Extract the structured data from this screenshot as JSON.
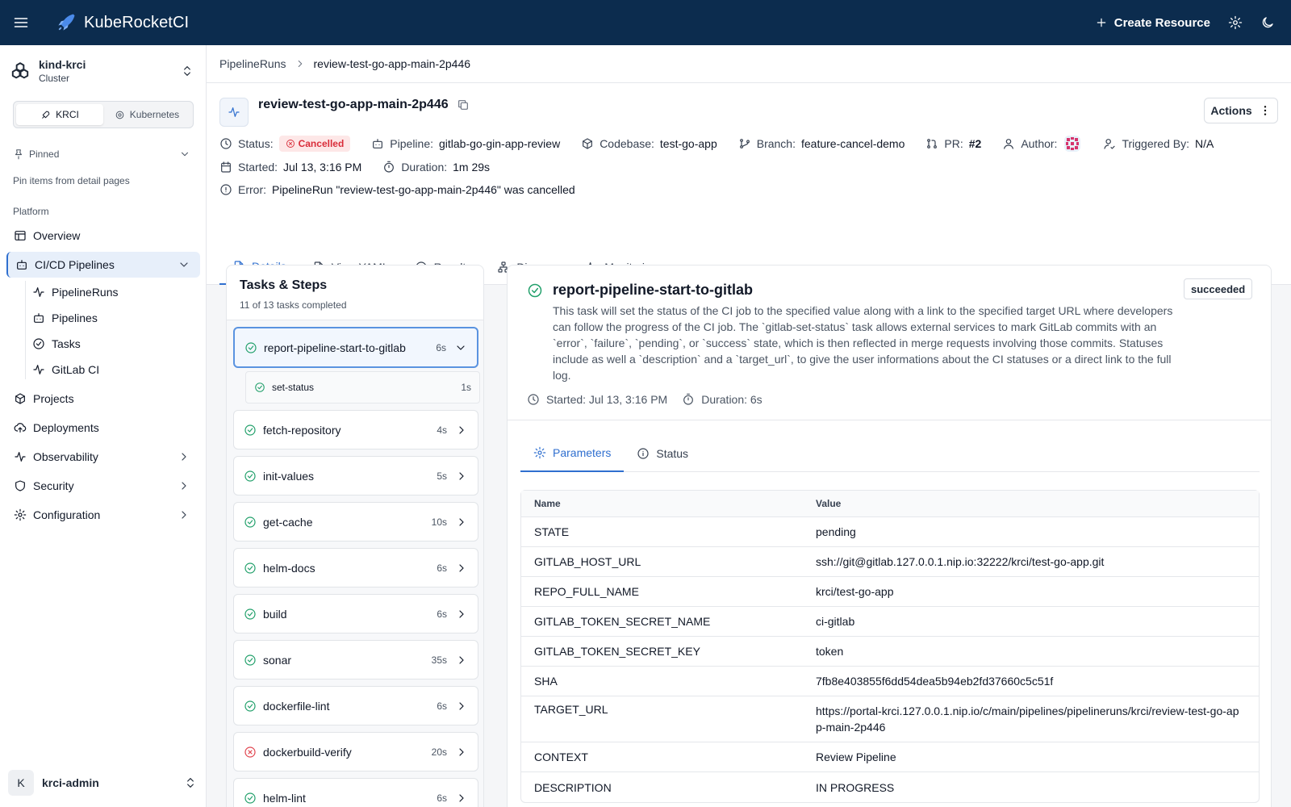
{
  "app": {
    "title": "KubeRocketCI",
    "create_label": "Create Resource"
  },
  "cluster": {
    "name": "kind-krci",
    "type": "Cluster"
  },
  "switcher": {
    "items": [
      "KRCI",
      "Kubernetes"
    ],
    "active": "KRCI"
  },
  "pinned": {
    "label": "Pinned",
    "hint": "Pin items from detail pages"
  },
  "sidebar": {
    "section": "Platform",
    "items": [
      {
        "label": "Overview",
        "icon": "layout-icon"
      },
      {
        "label": "CI/CD Pipelines",
        "icon": "bot-icon",
        "active": true
      },
      {
        "label": "Projects",
        "icon": "box-icon"
      },
      {
        "label": "Deployments",
        "icon": "cloud-upload-icon"
      },
      {
        "label": "Observability",
        "icon": "activity-icon"
      },
      {
        "label": "Security",
        "icon": "shield-icon"
      },
      {
        "label": "Configuration",
        "icon": "gear-icon"
      }
    ],
    "subitems": [
      {
        "label": "PipelineRuns",
        "icon": "activity-icon"
      },
      {
        "label": "Pipelines",
        "icon": "bot-icon"
      },
      {
        "label": "Tasks",
        "icon": "check-circle-icon"
      },
      {
        "label": "GitLab CI",
        "icon": "activity-icon"
      }
    ]
  },
  "user": {
    "initial": "K",
    "name": "krci-admin"
  },
  "breadcrumb": {
    "parent": "PipelineRuns",
    "current": "review-test-go-app-main-2p446"
  },
  "run": {
    "name": "review-test-go-app-main-2p446",
    "actions_label": "Actions",
    "status_label": "Status:",
    "status": "Cancelled",
    "pipeline_label": "Pipeline:",
    "pipeline": "gitlab-go-gin-app-review",
    "codebase_label": "Codebase:",
    "codebase": "test-go-app",
    "branch_label": "Branch:",
    "branch": "feature-cancel-demo",
    "pr_label": "PR:",
    "pr": "#2",
    "author_label": "Author:",
    "triggered_label": "Triggered By:",
    "triggered": "N/A",
    "started_label": "Started:",
    "started": "Jul 13, 3:16 PM",
    "duration_label": "Duration:",
    "duration": "1m 29s",
    "error_label": "Error:",
    "error": "PipelineRun \"review-test-go-app-main-2p446\" was cancelled"
  },
  "tabs": [
    "Details",
    "View YAML",
    "Results",
    "Diagram",
    "Monitoring"
  ],
  "tasks": {
    "title": "Tasks & Steps",
    "summary": "11 of 13 tasks completed",
    "items": [
      {
        "name": "report-pipeline-start-to-gitlab",
        "duration": "6s",
        "status": "succeeded",
        "expanded": true
      },
      {
        "name": "fetch-repository",
        "duration": "4s",
        "status": "succeeded"
      },
      {
        "name": "init-values",
        "duration": "5s",
        "status": "succeeded"
      },
      {
        "name": "get-cache",
        "duration": "10s",
        "status": "succeeded"
      },
      {
        "name": "helm-docs",
        "duration": "6s",
        "status": "succeeded"
      },
      {
        "name": "build",
        "duration": "6s",
        "status": "succeeded"
      },
      {
        "name": "sonar",
        "duration": "35s",
        "status": "succeeded"
      },
      {
        "name": "dockerfile-lint",
        "duration": "6s",
        "status": "succeeded"
      },
      {
        "name": "dockerbuild-verify",
        "duration": "20s",
        "status": "failed"
      },
      {
        "name": "helm-lint",
        "duration": "6s",
        "status": "succeeded"
      }
    ],
    "steps": [
      {
        "name": "set-status",
        "duration": "1s"
      }
    ]
  },
  "detail": {
    "title": "report-pipeline-start-to-gitlab",
    "badge": "succeeded",
    "description": "This task will set the status of the CI job to the specified value along with a link to the specified target URL where developers can follow the progress of the CI job. The `gitlab-set-status` task allows external services to mark GitLab commits with an `error`, `failure`, `pending`, or `success` state, which is then reflected in merge requests involving those commits. Statuses include as well a `description` and a `target_url`, to give the user informations about the CI statuses or a direct link to the full log.",
    "started": "Started: Jul 13, 3:16 PM",
    "duration": "Duration: 6s",
    "tabs": [
      "Parameters",
      "Status"
    ],
    "param_headers": [
      "Name",
      "Value"
    ],
    "params": [
      {
        "name": "STATE",
        "value": "pending"
      },
      {
        "name": "GITLAB_HOST_URL",
        "value": "ssh://git@gitlab.127.0.0.1.nip.io:32222/krci/test-go-app.git"
      },
      {
        "name": "REPO_FULL_NAME",
        "value": "krci/test-go-app"
      },
      {
        "name": "GITLAB_TOKEN_SECRET_NAME",
        "value": "ci-gitlab"
      },
      {
        "name": "GITLAB_TOKEN_SECRET_KEY",
        "value": "token"
      },
      {
        "name": "SHA",
        "value": "7fb8e403855f6dd54dea5b94eb2fd37660c5c51f"
      },
      {
        "name": "TARGET_URL",
        "value": "https://portal-krci.127.0.0.1.nip.io/c/main/pipelines/pipelineruns/krci/review-test-go-app-main-2p446"
      },
      {
        "name": "CONTEXT",
        "value": "Review Pipeline"
      },
      {
        "name": "DESCRIPTION",
        "value": "IN PROGRESS"
      }
    ]
  },
  "colors": {
    "topbar": "#0c2c4e",
    "accent": "#2f6fcf",
    "success": "#22a06b",
    "error": "#e0454f"
  }
}
